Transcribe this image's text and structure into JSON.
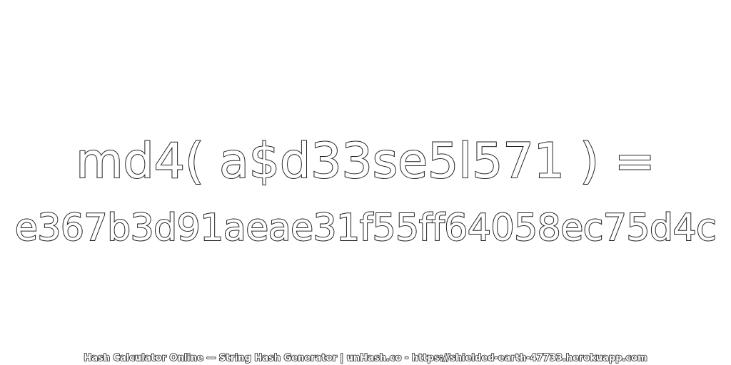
{
  "expression": "md4( a$d33se5l571 ) =",
  "hash": "e367b3d91aeae31f55ff64058ec75d4c",
  "footer": "Hash Calculator Online — String Hash Generator | unHash.co - https://shielded-earth-47733.herokuapp.com"
}
